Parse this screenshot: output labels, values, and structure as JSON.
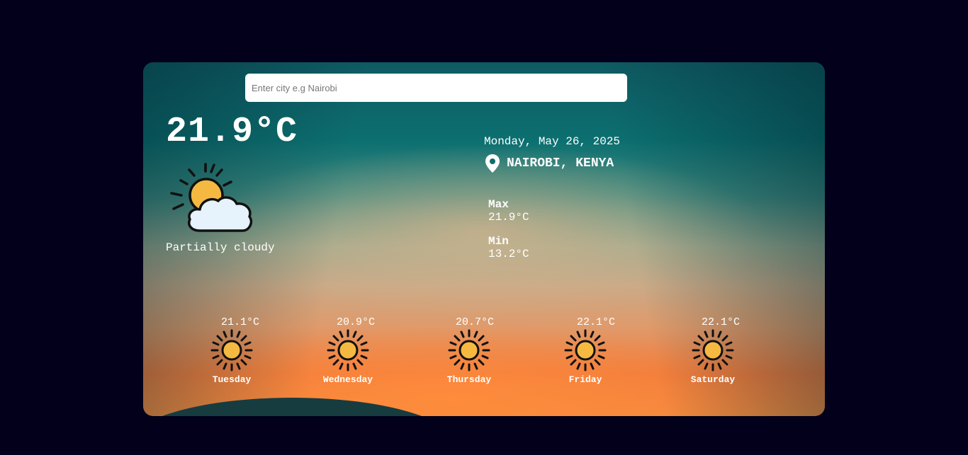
{
  "search": {
    "placeholder": "Enter city e.g Nairobi",
    "value": ""
  },
  "current": {
    "temperature": "21.9°C",
    "condition": "Partially cloudy",
    "icon": "partly-cloudy-icon",
    "date": "Monday, May 26, 2025",
    "location": "NAIROBI, KENYA",
    "max_label": "Max",
    "max_value": "21.9°C",
    "min_label": "Min",
    "min_value": "13.2°C"
  },
  "forecast": [
    {
      "temp": "21.1°C",
      "day": "Tuesday",
      "icon": "sun-icon"
    },
    {
      "temp": "20.9°C",
      "day": "Wednesday",
      "icon": "sun-icon"
    },
    {
      "temp": "20.7°C",
      "day": "Thursday",
      "icon": "sun-icon"
    },
    {
      "temp": "22.1°C",
      "day": "Friday",
      "icon": "sun-icon"
    },
    {
      "temp": "22.1°C",
      "day": "Saturday",
      "icon": "sun-icon"
    }
  ],
  "colors": {
    "page_background": "#02001a",
    "sun_fill": "#f5b942",
    "cloud_fill": "#e6f2fc"
  }
}
